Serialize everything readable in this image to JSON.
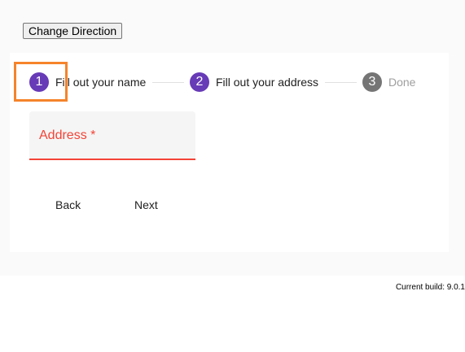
{
  "toolbar": {
    "change_direction_label": "Change Direction"
  },
  "stepper": {
    "steps": [
      {
        "number": "1",
        "label": "Fill out your name",
        "state": "active"
      },
      {
        "number": "2",
        "label": "Fill out your address",
        "state": "active"
      },
      {
        "number": "3",
        "label": "Done",
        "state": "inactive"
      }
    ]
  },
  "form": {
    "address_label": "Address *"
  },
  "buttons": {
    "back_label": "Back",
    "next_label": "Next"
  },
  "footer": {
    "build_text": "Current build: 9.0.1"
  },
  "colors": {
    "accent": "#673ab7",
    "error": "#f44336",
    "inactive_step": "#757575",
    "highlight": "#f5842a"
  }
}
